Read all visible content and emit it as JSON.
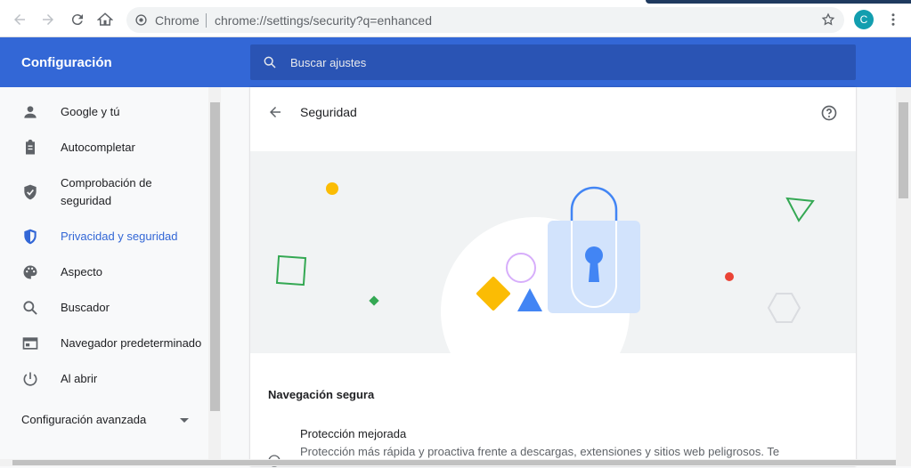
{
  "browser": {
    "scheme_label": "Chrome",
    "url": "chrome://settings/security?q=enhanced",
    "avatar_letter": "C"
  },
  "header": {
    "title": "Configuración",
    "search_placeholder": "Buscar ajustes"
  },
  "sidebar": {
    "items": [
      {
        "label": "Google y tú",
        "icon": "person-icon"
      },
      {
        "label": "Autocompletar",
        "icon": "clipboard-icon"
      },
      {
        "label": "Comprobación de",
        "label2": "seguridad",
        "icon": "shield-check-icon"
      },
      {
        "label": "Privacidad y seguridad",
        "icon": "shield-half-icon",
        "active": true
      },
      {
        "label": "Aspecto",
        "icon": "palette-icon"
      },
      {
        "label": "Buscador",
        "icon": "search-icon"
      },
      {
        "label": "Navegador predeterminado",
        "icon": "browser-window-icon"
      },
      {
        "label": "Al abrir",
        "icon": "power-icon"
      }
    ],
    "advanced": "Configuración avanzada"
  },
  "page": {
    "title": "Seguridad",
    "section_title": "Navegación segura",
    "option_title": "Protección mejorada",
    "option_desc": "Protección más rápida y proactiva frente a descargas, extensiones y sitios web peligrosos. Te"
  },
  "colors": {
    "brand_blue": "#3367d6",
    "header_search": "#2a54b4"
  }
}
